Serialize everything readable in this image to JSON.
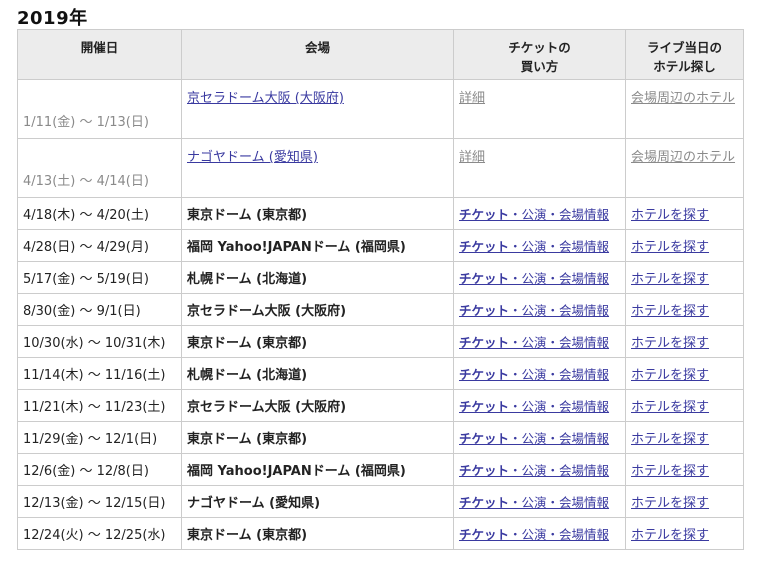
{
  "year_title": "2019年",
  "headers": {
    "date": "開催日",
    "venue": "会場",
    "ticket_line1": "チケットの",
    "ticket_line2": "買い方",
    "hotel_line1": "ライブ当日の",
    "hotel_line2": "ホテル探し"
  },
  "past_rows": [
    {
      "date": "1/11(金) 〜 1/13(日)",
      "venue": "京セラドーム大阪 (大阪府)",
      "detail": "詳細",
      "hotel": "会場周辺のホテル"
    },
    {
      "date": "4/13(土) 〜 4/14(日)",
      "venue": "ナゴヤドーム (愛知県)",
      "detail": "詳細",
      "hotel": "会場周辺のホテル"
    }
  ],
  "ticket_link": {
    "bold": "チケット",
    "rest": "・公演・会場情報"
  },
  "hotel_link": "ホテルを探す",
  "rows": [
    {
      "date": "4/18(木) 〜 4/20(土)",
      "venue": "東京ドーム (東京都)"
    },
    {
      "date": "4/28(日) 〜 4/29(月)",
      "venue": "福岡 Yahoo!JAPANドーム (福岡県)"
    },
    {
      "date": "5/17(金) 〜 5/19(日)",
      "venue": "札幌ドーム (北海道)"
    },
    {
      "date": "8/30(金) 〜 9/1(日)",
      "venue": "京セラドーム大阪 (大阪府)"
    },
    {
      "date": "10/30(水) 〜 10/31(木)",
      "venue": "東京ドーム (東京都)"
    },
    {
      "date": "11/14(木) 〜 11/16(土)",
      "venue": "札幌ドーム (北海道)"
    },
    {
      "date": "11/21(木) 〜 11/23(土)",
      "venue": "京セラドーム大阪 (大阪府)"
    },
    {
      "date": "11/29(金) 〜 12/1(日)",
      "venue": "東京ドーム (東京都)"
    },
    {
      "date": "12/6(金) 〜 12/8(日)",
      "venue": "福岡 Yahoo!JAPANドーム (福岡県)"
    },
    {
      "date": "12/13(金) 〜 12/15(日)",
      "venue": "ナゴヤドーム (愛知県)"
    },
    {
      "date": "12/24(火) 〜 12/25(水)",
      "venue": "東京ドーム (東京都)"
    }
  ]
}
